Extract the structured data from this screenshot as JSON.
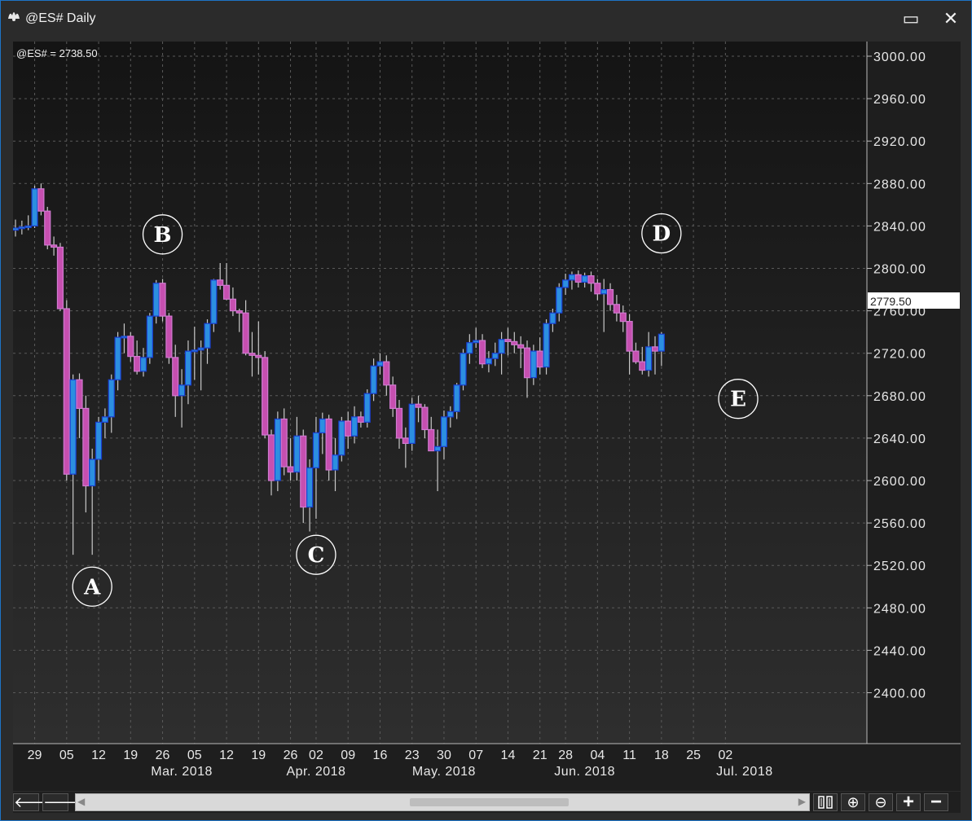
{
  "window": {
    "title": "@ES# Daily"
  },
  "titlebar": {
    "maximize_symbol": "▭",
    "close_symbol": "✕"
  },
  "chart": {
    "symbol_label": "@ES# = 2738.50",
    "current_price_label": "2779.50",
    "colors": {
      "up_body": "#2c8fe0",
      "up_border": "#1a3fd0",
      "down_body": "#c64fb0",
      "down_border": "#d07ad0",
      "wick": "#c8c8c8",
      "grid": "#5a5a5a"
    },
    "annotations": [
      {
        "letter": "A",
        "bar_index": 12,
        "price": 2500
      },
      {
        "letter": "B",
        "bar_index": 23,
        "price": 2832
      },
      {
        "letter": "C",
        "bar_index": 47,
        "price": 2530
      },
      {
        "letter": "D",
        "bar_index": 101,
        "price": 2833
      },
      {
        "letter": "E",
        "bar_index": 113,
        "price": 2677
      }
    ]
  },
  "chart_data": {
    "type": "candlestick",
    "title": "@ES# Daily",
    "ylim": [
      2360,
      3000
    ],
    "y_ticks": [
      "3000.00",
      "2960.00",
      "2920.00",
      "2880.00",
      "2840.00",
      "2800.00",
      "2760.00",
      "2720.00",
      "2680.00",
      "2640.00",
      "2600.00",
      "2560.00",
      "2520.00",
      "2480.00",
      "2440.00",
      "2400.00"
    ],
    "x_ticks": [
      {
        "label": "29",
        "bar": 3
      },
      {
        "label": "05",
        "bar": 8
      },
      {
        "label": "12",
        "bar": 13
      },
      {
        "label": "19",
        "bar": 18
      },
      {
        "label": "26",
        "bar": 23
      },
      {
        "label": "05",
        "bar": 28
      },
      {
        "label": "12",
        "bar": 33
      },
      {
        "label": "19",
        "bar": 38
      },
      {
        "label": "26",
        "bar": 43
      },
      {
        "label": "02",
        "bar": 47
      },
      {
        "label": "09",
        "bar": 52
      },
      {
        "label": "16",
        "bar": 57
      },
      {
        "label": "23",
        "bar": 62
      },
      {
        "label": "30",
        "bar": 67
      },
      {
        "label": "07",
        "bar": 72
      },
      {
        "label": "14",
        "bar": 77
      },
      {
        "label": "21",
        "bar": 82
      },
      {
        "label": "28",
        "bar": 86
      },
      {
        "label": "04",
        "bar": 91
      },
      {
        "label": "11",
        "bar": 96
      },
      {
        "label": "18",
        "bar": 101
      },
      {
        "label": "25",
        "bar": 106
      },
      {
        "label": "02",
        "bar": 111
      }
    ],
    "month_labels": [
      {
        "label": "Mar. 2018",
        "bar": 26
      },
      {
        "label": "Apr. 2018",
        "bar": 47
      },
      {
        "label": "May. 2018",
        "bar": 67
      },
      {
        "label": "Jun. 2018",
        "bar": 89
      },
      {
        "label": "Jul. 2018",
        "bar": 114
      }
    ],
    "ohlc": [
      [
        2836,
        2846,
        2830,
        2838
      ],
      [
        2838,
        2845,
        2832,
        2839
      ],
      [
        2839,
        2850,
        2836,
        2840
      ],
      [
        2840,
        2878,
        2838,
        2875
      ],
      [
        2875,
        2880,
        2850,
        2854
      ],
      [
        2854,
        2858,
        2818,
        2822
      ],
      [
        2822,
        2830,
        2812,
        2820
      ],
      [
        2820,
        2824,
        2760,
        2762
      ],
      [
        2762,
        2770,
        2600,
        2606
      ],
      [
        2606,
        2700,
        2530,
        2695
      ],
      [
        2695,
        2701,
        2640,
        2668
      ],
      [
        2668,
        2680,
        2570,
        2595
      ],
      [
        2595,
        2630,
        2530,
        2620
      ],
      [
        2620,
        2660,
        2600,
        2655
      ],
      [
        2655,
        2668,
        2640,
        2660
      ],
      [
        2660,
        2700,
        2645,
        2695
      ],
      [
        2695,
        2740,
        2685,
        2735
      ],
      [
        2735,
        2748,
        2720,
        2736
      ],
      [
        2736,
        2740,
        2712,
        2717
      ],
      [
        2717,
        2732,
        2700,
        2703
      ],
      [
        2703,
        2725,
        2698,
        2716
      ],
      [
        2716,
        2758,
        2710,
        2755
      ],
      [
        2755,
        2789,
        2748,
        2786
      ],
      [
        2786,
        2790,
        2750,
        2755
      ],
      [
        2755,
        2758,
        2710,
        2716
      ],
      [
        2716,
        2728,
        2660,
        2680
      ],
      [
        2680,
        2705,
        2650,
        2690
      ],
      [
        2690,
        2732,
        2672,
        2722
      ],
      [
        2722,
        2745,
        2695,
        2723
      ],
      [
        2723,
        2732,
        2685,
        2725
      ],
      [
        2725,
        2752,
        2710,
        2748
      ],
      [
        2748,
        2790,
        2740,
        2789
      ],
      [
        2789,
        2805,
        2780,
        2784
      ],
      [
        2784,
        2805,
        2770,
        2771
      ],
      [
        2771,
        2782,
        2755,
        2760
      ],
      [
        2760,
        2762,
        2740,
        2758
      ],
      [
        2758,
        2770,
        2718,
        2720
      ],
      [
        2720,
        2740,
        2698,
        2718
      ],
      [
        2718,
        2750,
        2700,
        2716
      ],
      [
        2716,
        2722,
        2640,
        2643
      ],
      [
        2643,
        2648,
        2586,
        2600
      ],
      [
        2600,
        2665,
        2590,
        2658
      ],
      [
        2658,
        2668,
        2605,
        2613
      ],
      [
        2613,
        2640,
        2600,
        2608
      ],
      [
        2608,
        2660,
        2600,
        2642
      ],
      [
        2642,
        2648,
        2560,
        2575
      ],
      [
        2575,
        2620,
        2552,
        2612
      ],
      [
        2612,
        2660,
        2564,
        2645
      ],
      [
        2645,
        2664,
        2625,
        2658
      ],
      [
        2658,
        2662,
        2600,
        2610
      ],
      [
        2610,
        2640,
        2590,
        2624
      ],
      [
        2624,
        2660,
        2618,
        2656
      ],
      [
        2656,
        2665,
        2630,
        2642
      ],
      [
        2642,
        2670,
        2635,
        2660
      ],
      [
        2660,
        2665,
        2650,
        2655
      ],
      [
        2655,
        2686,
        2650,
        2682
      ],
      [
        2682,
        2715,
        2675,
        2708
      ],
      [
        2708,
        2720,
        2700,
        2712
      ],
      [
        2712,
        2718,
        2680,
        2690
      ],
      [
        2690,
        2698,
        2660,
        2668
      ],
      [
        2668,
        2676,
        2630,
        2640
      ],
      [
        2640,
        2650,
        2612,
        2635
      ],
      [
        2635,
        2678,
        2628,
        2672
      ],
      [
        2672,
        2680,
        2655,
        2669
      ],
      [
        2669,
        2672,
        2640,
        2648
      ],
      [
        2648,
        2660,
        2628,
        2628
      ],
      [
        2628,
        2648,
        2590,
        2632
      ],
      [
        2632,
        2666,
        2620,
        2660
      ],
      [
        2660,
        2670,
        2650,
        2665
      ],
      [
        2665,
        2692,
        2658,
        2690
      ],
      [
        2690,
        2724,
        2685,
        2720
      ],
      [
        2720,
        2738,
        2710,
        2730
      ],
      [
        2730,
        2744,
        2725,
        2732
      ],
      [
        2732,
        2738,
        2706,
        2710
      ],
      [
        2710,
        2722,
        2702,
        2715
      ],
      [
        2715,
        2730,
        2708,
        2720
      ],
      [
        2720,
        2740,
        2700,
        2733
      ],
      [
        2733,
        2744,
        2718,
        2731
      ],
      [
        2731,
        2740,
        2720,
        2728
      ],
      [
        2728,
        2736,
        2706,
        2725
      ],
      [
        2725,
        2732,
        2678,
        2697
      ],
      [
        2697,
        2728,
        2690,
        2722
      ],
      [
        2722,
        2735,
        2700,
        2707
      ],
      [
        2707,
        2752,
        2700,
        2748
      ],
      [
        2748,
        2762,
        2740,
        2758
      ],
      [
        2758,
        2786,
        2750,
        2782
      ],
      [
        2782,
        2795,
        2775,
        2789
      ],
      [
        2789,
        2797,
        2780,
        2794
      ],
      [
        2794,
        2798,
        2782,
        2787
      ],
      [
        2787,
        2796,
        2782,
        2793
      ],
      [
        2793,
        2797,
        2778,
        2786
      ],
      [
        2786,
        2790,
        2770,
        2776
      ],
      [
        2776,
        2790,
        2740,
        2780
      ],
      [
        2780,
        2786,
        2760,
        2766
      ],
      [
        2766,
        2775,
        2750,
        2758
      ],
      [
        2758,
        2765,
        2740,
        2750
      ],
      [
        2750,
        2757,
        2700,
        2722
      ],
      [
        2722,
        2730,
        2710,
        2712
      ],
      [
        2712,
        2726,
        2700,
        2704
      ],
      [
        2704,
        2740,
        2698,
        2726
      ],
      [
        2726,
        2736,
        2700,
        2722
      ],
      [
        2722,
        2740,
        2708,
        2738
      ]
    ]
  },
  "bottombar": {
    "scroll_left_symbol": "🡐",
    "scroll_right_symbol": "🡒",
    "zoom_in_symbol": "⊕",
    "zoom_out_symbol": "⊖",
    "add_symbol": "+",
    "remove_symbol": "−"
  }
}
